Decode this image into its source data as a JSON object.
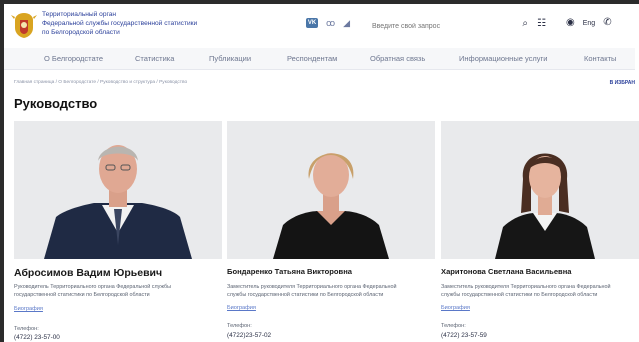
{
  "header": {
    "org_lines": [
      "Территориальный орган",
      "Федеральной службы государственной статистики",
      "по Белгородской области"
    ],
    "social": {
      "vk_label": "VK",
      "ok_glyph": "ꝏ",
      "tg_glyph": "◢"
    },
    "search": {
      "placeholder": "Введите свой запрос"
    },
    "lang_label": "Eng"
  },
  "nav": [
    "О Белгородстате",
    "Статистика",
    "Публикации",
    "Респондентам",
    "Обратная связь",
    "Информационные услуги",
    "Контакты"
  ],
  "breadcrumb": "Главная страница / О Белгородстате / Руководство и структура / Руководство",
  "favorites_label": "В ИЗБРАН",
  "page_title": "Руководство",
  "people": [
    {
      "name": "Абросимов Вадим Юрьевич",
      "role_lines": [
        "Руководитель Территориального органа Федеральной службы",
        "государственной статистики по Белгородской области"
      ],
      "bio_label": "Биография",
      "phone_label": "Телефон:",
      "phone": "(4722) 23-57-00"
    },
    {
      "name": "Бондаренко Татьяна Викторовна",
      "role_lines": [
        "Заместитель руководителя Территориального органа Федеральной",
        "службы государственной статистики по Белгородской области"
      ],
      "bio_label": "Биография",
      "phone_label": "Телефон:",
      "phone": "(4722)23-57-02"
    },
    {
      "name": "Харитонова Светлана Васильевна",
      "role_lines": [
        "Заместитель руководителя Территориального органа Федеральной",
        "службы государственной статистики по Белгородской области"
      ],
      "bio_label": "Биография",
      "phone_label": "Телефон:",
      "phone": "(4722) 23-57-59"
    }
  ],
  "colors": {
    "brand": "#2a3f9a",
    "link": "#5a78c8",
    "nav_bg": "#f6f7f9",
    "photo_bg": "#e9eaec"
  }
}
